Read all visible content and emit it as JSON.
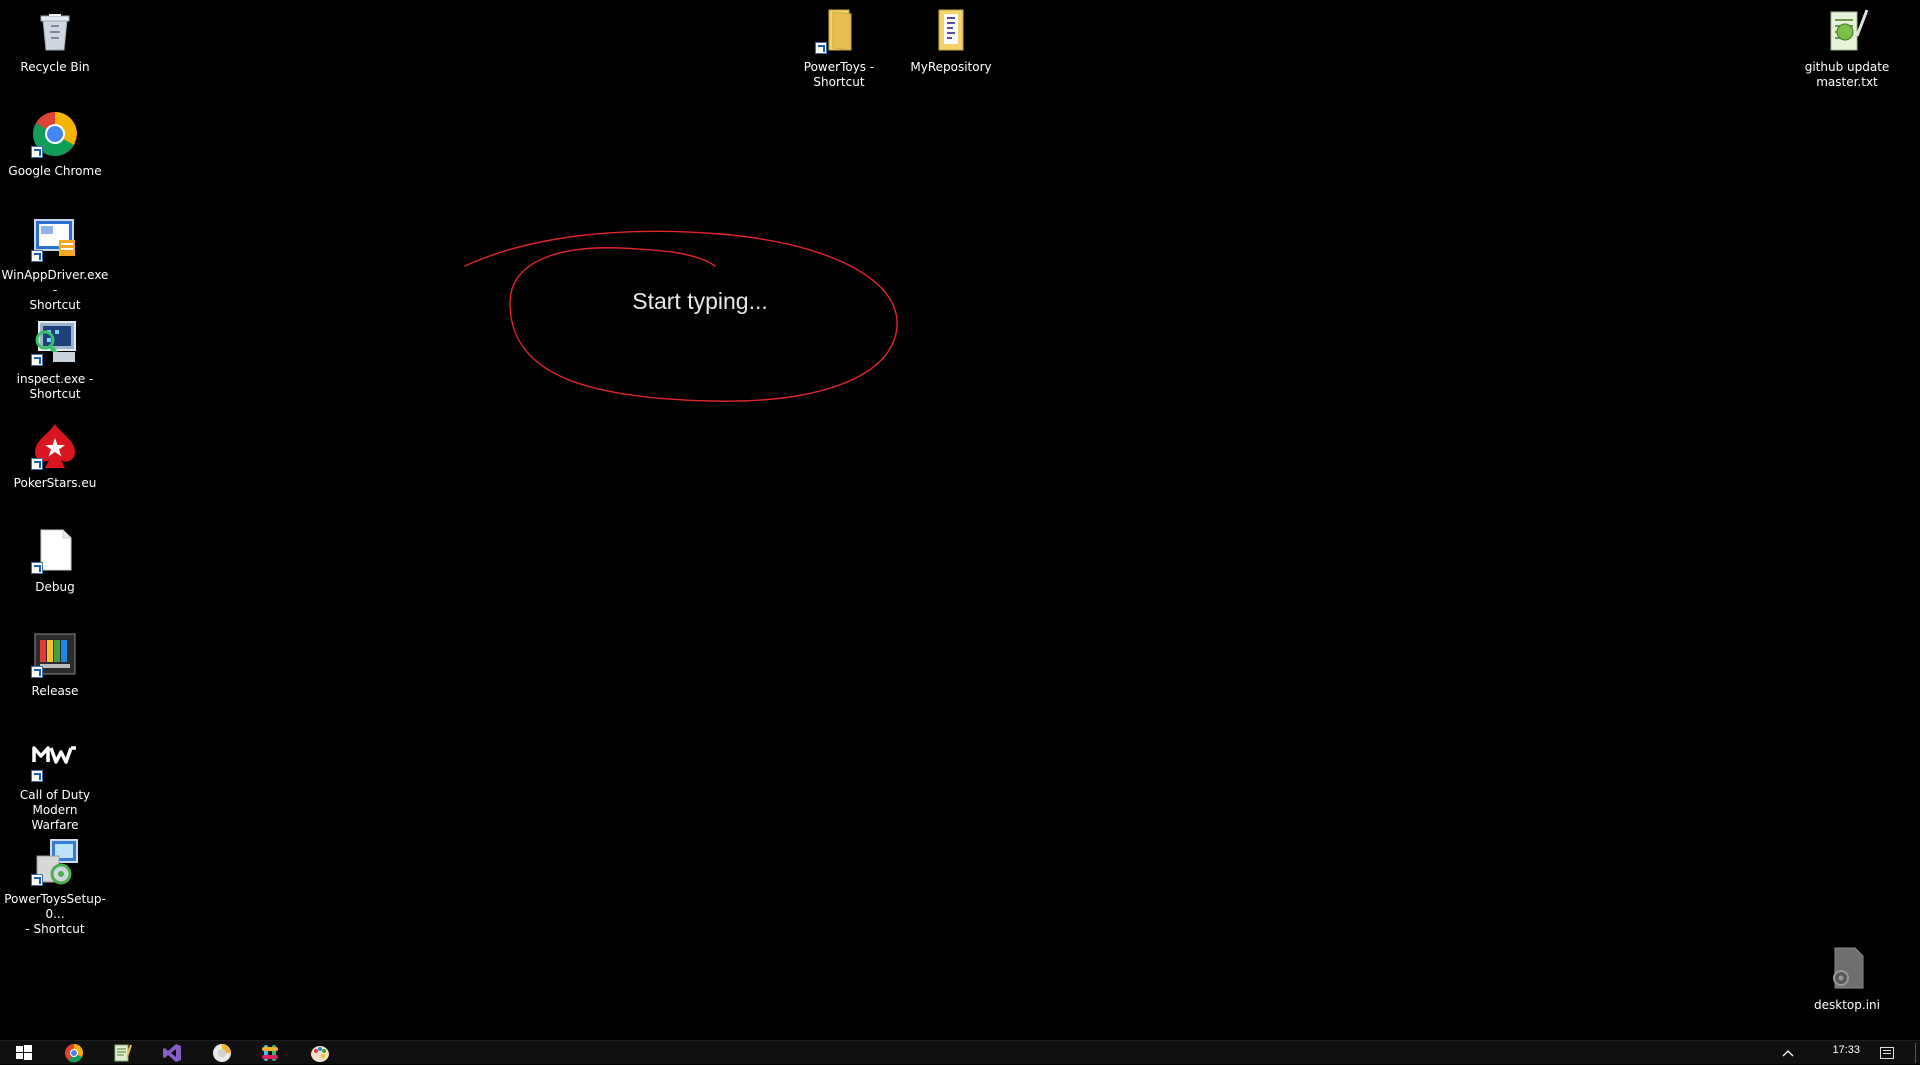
{
  "desktop": {
    "icons": [
      {
        "label": "Recycle Bin",
        "icon": "recycle-bin-icon"
      },
      {
        "label": "Google Chrome",
        "icon": "chrome-icon"
      },
      {
        "label": "WinAppDriver.exe -\nShortcut",
        "icon": "winappdriver-icon"
      },
      {
        "label": "inspect.exe -\nShortcut",
        "icon": "inspect-icon"
      },
      {
        "label": "PokerStars.eu",
        "icon": "pokerstars-icon"
      },
      {
        "label": "Debug",
        "icon": "file-icon"
      },
      {
        "label": "Release",
        "icon": "release-icon"
      },
      {
        "label": "Call of Duty Modern\nWarfare",
        "icon": "cod-mw-icon"
      },
      {
        "label": "PowerToysSetup-0...\n- Shortcut",
        "icon": "installer-icon"
      },
      {
        "label": "PowerToys -\nShortcut",
        "icon": "folder-icon"
      },
      {
        "label": "MyRepository",
        "icon": "folder-icon"
      },
      {
        "label": "github update\nmaster.txt",
        "icon": "notepad-icon"
      },
      {
        "label": "desktop.ini",
        "icon": "settings-file-icon"
      }
    ]
  },
  "overlay": {
    "prompt": "Start typing...",
    "ink_color": "#e0262b"
  },
  "taskbar": {
    "clock": "17:33",
    "apps": [
      "start-icon",
      "chrome-icon",
      "notepad-icon",
      "visual-studio-icon",
      "clock-app-icon",
      "slack-icon",
      "paint-icon"
    ]
  }
}
